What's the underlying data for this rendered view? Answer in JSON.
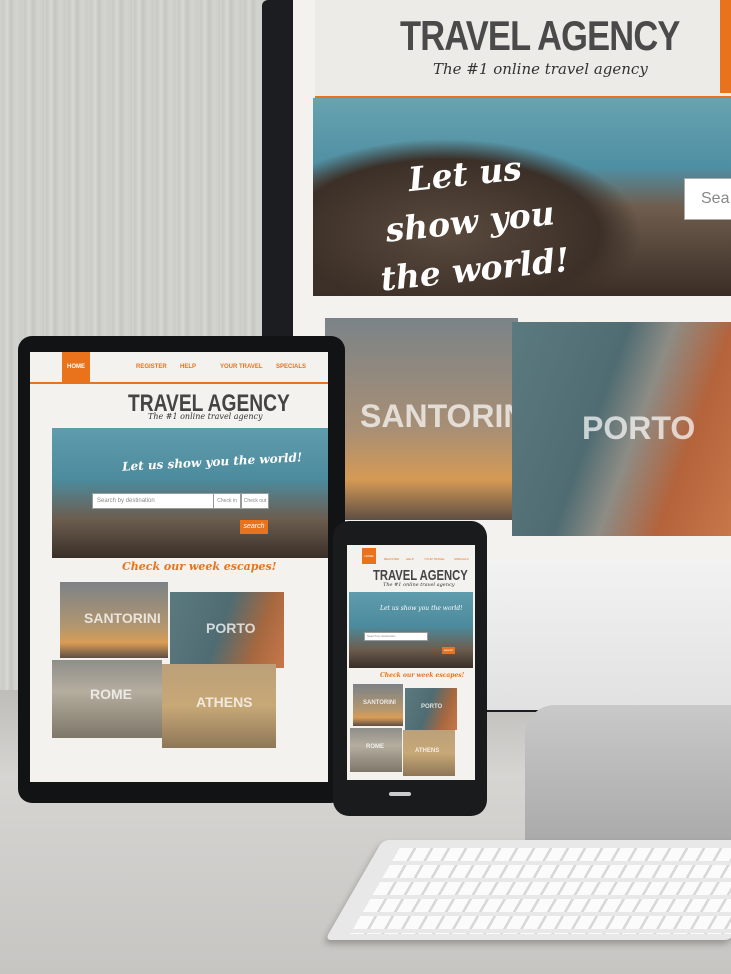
{
  "site": {
    "brand": "TRAVEL AGENCY",
    "tagline": "The #1 online travel agency",
    "hero_text": "Let us show you the world!",
    "search_placeholder": "Search by destination",
    "search_placeholder_short": "Sea",
    "search_button": "search",
    "escapes_heading": "Check our week escapes!",
    "nav": [
      "HOME",
      "REGISTER",
      "HELP",
      "YOUR TRAVEL",
      "SPECIALS"
    ],
    "small_fields": [
      "Check in",
      "Check out"
    ],
    "destinations": [
      "SANTORINI",
      "PORTO",
      "ROME",
      "ATHENS"
    ]
  },
  "colors": {
    "accent": "#e8731c",
    "title_text": "#444444",
    "background": "#f4f2ee"
  },
  "icons": [
    "search-icon"
  ]
}
